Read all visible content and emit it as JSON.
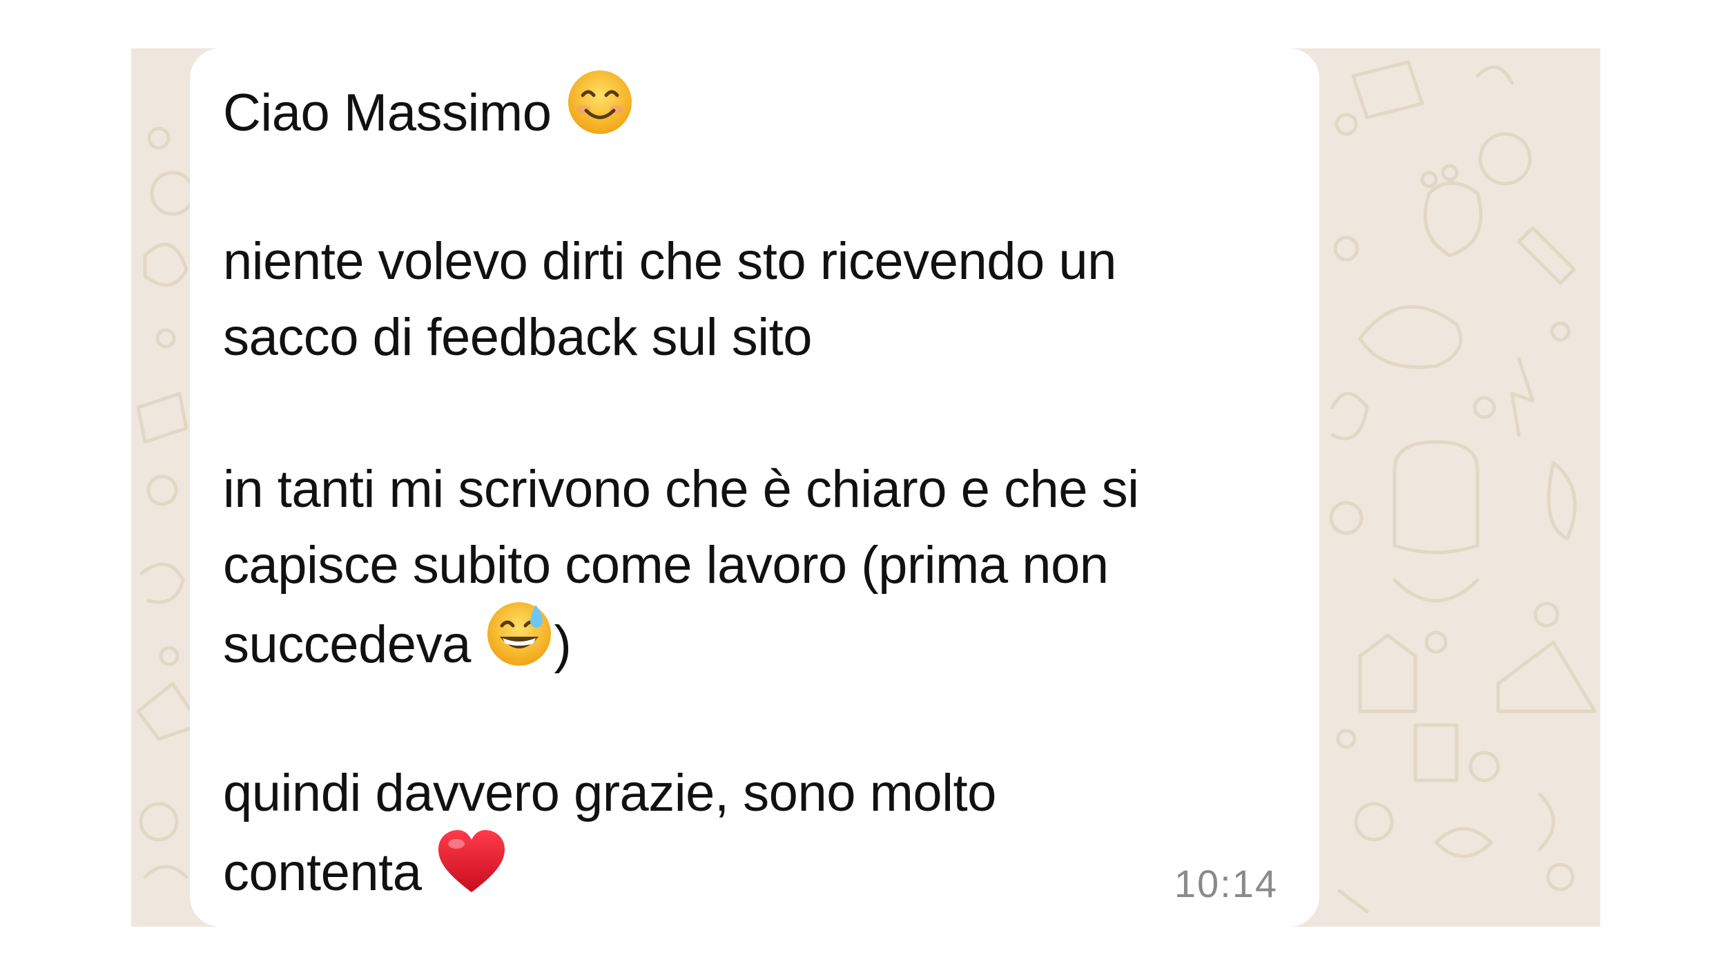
{
  "message": {
    "greeting_text": "Ciao Massimo",
    "greeting_emoji": "smiling-face-icon",
    "line1": "niente volevo dirti che sto ricevendo un",
    "line2": "sacco di feedback sul sito",
    "line3": "in tanti mi scrivono che è chiaro e che si",
    "line4": "capisce subito come lavoro (prima non",
    "line5_start": "succedeva",
    "line5_emoji": "grinning-sweat-face-icon",
    "line5_end": ")",
    "line6": "quindi davvero grazie, sono molto",
    "line7": "contenta",
    "line7_emoji": "red-heart-icon",
    "time": "10:14"
  },
  "colors": {
    "chat_background": "#efe7dd",
    "bubble": "#ffffff",
    "text": "#111111",
    "timestamp": "#8a8a8a",
    "emoji_face": "#fbc02d",
    "heart": "#e0182d"
  }
}
